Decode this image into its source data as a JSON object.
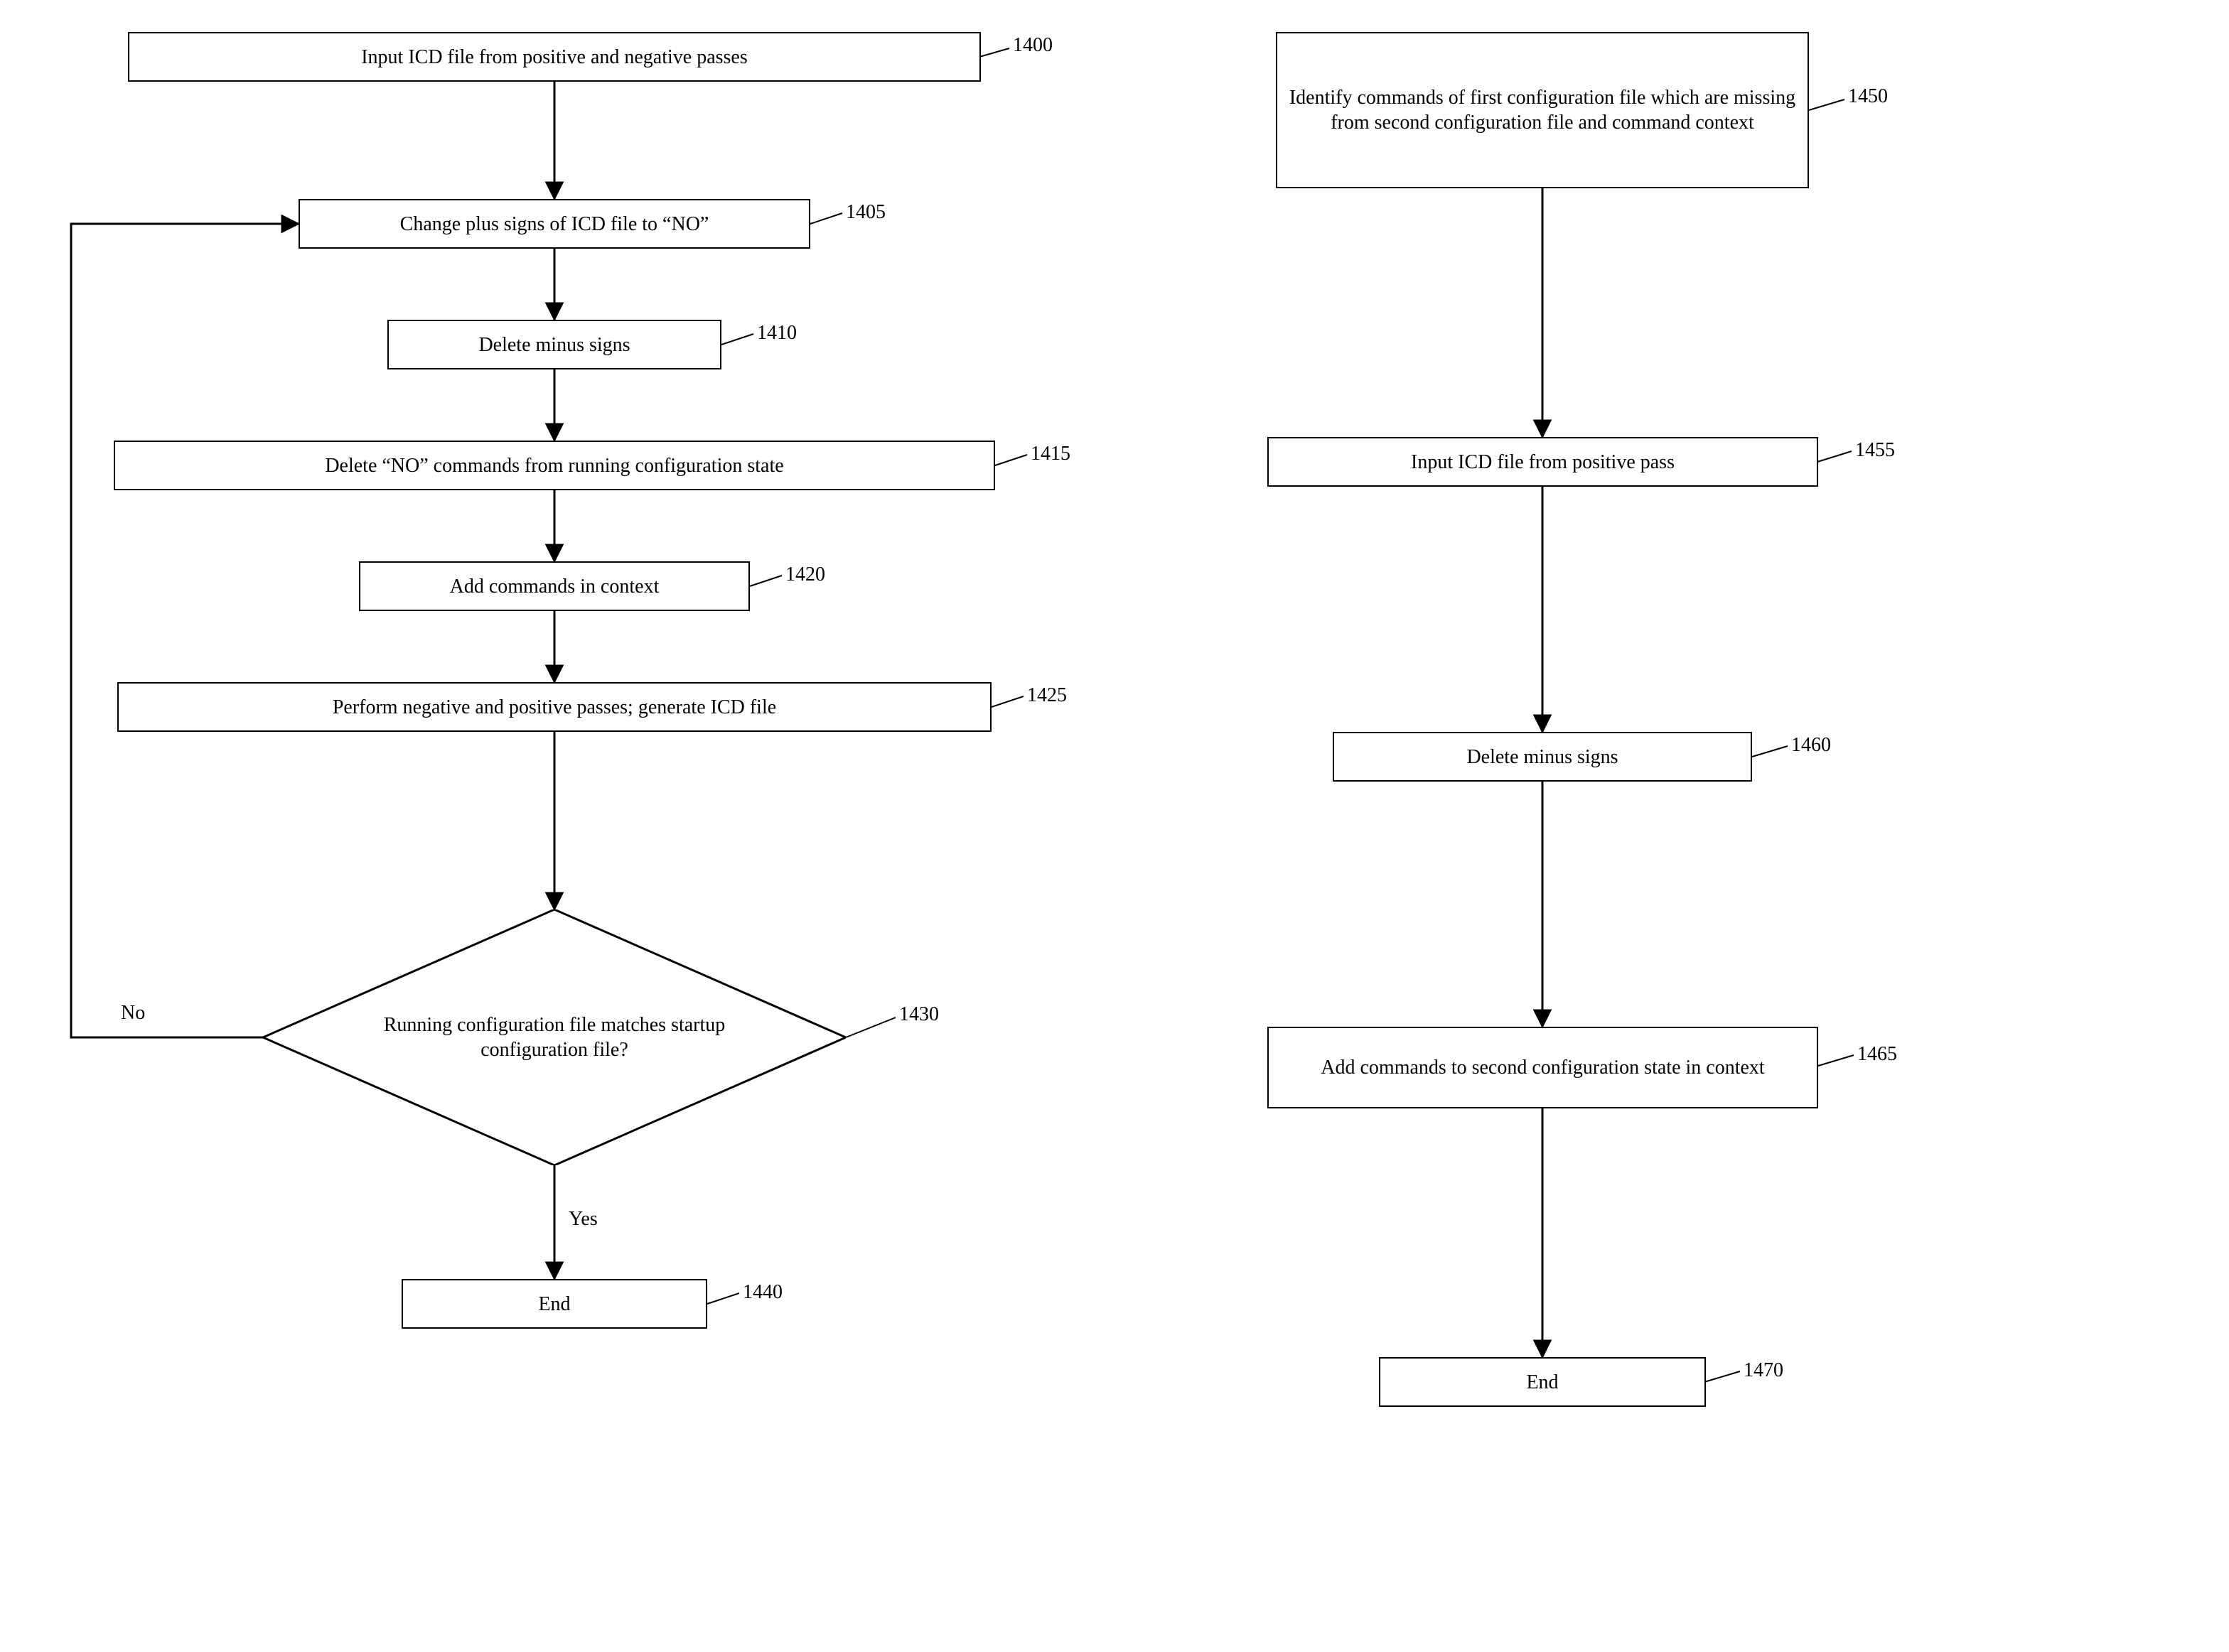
{
  "left": {
    "n1400": {
      "text": "Input ICD file from positive and negative passes",
      "ref": "1400"
    },
    "n1405": {
      "text": "Change plus signs of ICD file to “NO”",
      "ref": "1405"
    },
    "n1410": {
      "text": "Delete minus signs",
      "ref": "1410"
    },
    "n1415": {
      "text": "Delete “NO” commands from running configuration state",
      "ref": "1415"
    },
    "n1420": {
      "text": "Add commands in context",
      "ref": "1420"
    },
    "n1425": {
      "text": "Perform negative and positive passes; generate ICD file",
      "ref": "1425"
    },
    "n1430": {
      "text": "Running configuration file matches startup configuration file?",
      "ref": "1430"
    },
    "n1440": {
      "text": "End",
      "ref": "1440"
    },
    "yes": "Yes",
    "no": "No"
  },
  "right": {
    "n1450": {
      "text": "Identify commands of first configuration file which are missing from second configuration file and command  context",
      "ref": "1450"
    },
    "n1455": {
      "text": "Input ICD file from positive pass",
      "ref": "1455"
    },
    "n1460": {
      "text": "Delete minus signs",
      "ref": "1460"
    },
    "n1465": {
      "text": "Add commands to second configuration state in context",
      "ref": "1465"
    },
    "n1470": {
      "text": "End",
      "ref": "1470"
    }
  }
}
